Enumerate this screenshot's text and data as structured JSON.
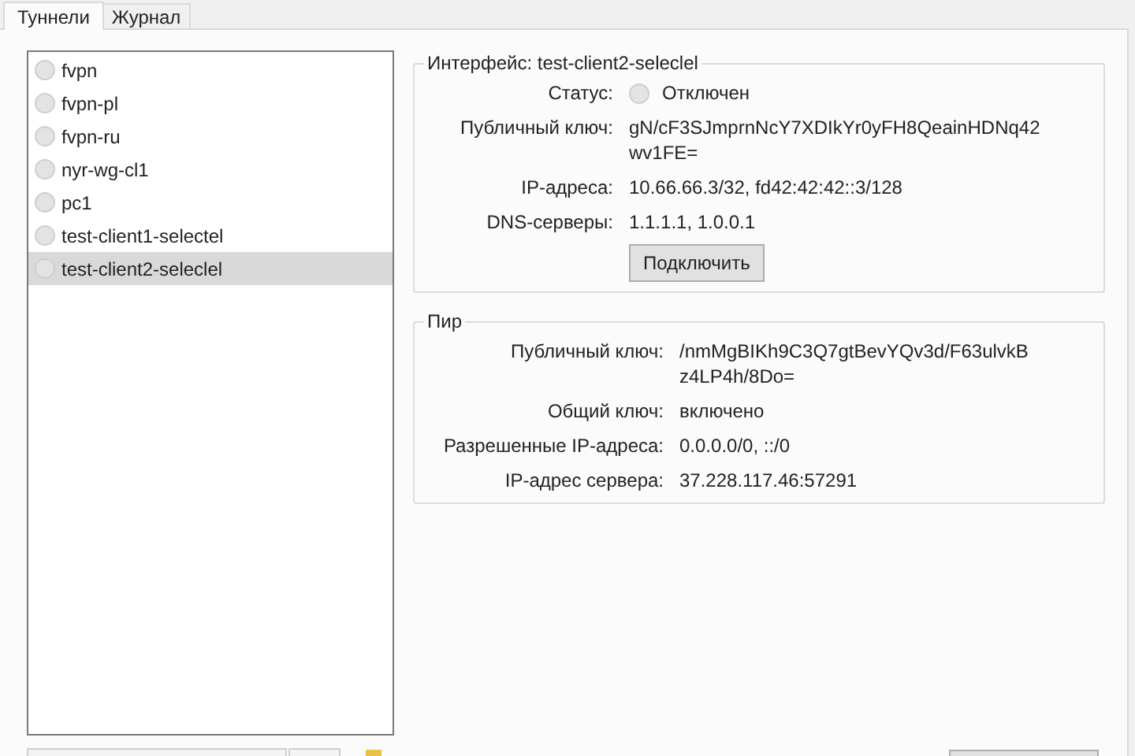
{
  "tabs": [
    {
      "label": "Туннели",
      "selected": true
    },
    {
      "label": "Журнал",
      "selected": false
    }
  ],
  "tunnels": [
    {
      "name": "fvpn",
      "active": false,
      "selected": false
    },
    {
      "name": "fvpn-pl",
      "active": false,
      "selected": false
    },
    {
      "name": "fvpn-ru",
      "active": false,
      "selected": false
    },
    {
      "name": "nyr-wg-cl1",
      "active": false,
      "selected": false
    },
    {
      "name": "pc1",
      "active": false,
      "selected": false
    },
    {
      "name": "test-client1-selectel",
      "active": false,
      "selected": false
    },
    {
      "name": "test-client2-seleclel",
      "active": false,
      "selected": true
    }
  ],
  "interface": {
    "title": "Интерфейс: test-client2-seleclel",
    "status_label": "Статус:",
    "status": "Отключен",
    "active": false,
    "rows": [
      {
        "label": "Публичный ключ:",
        "value": [
          "gN/cF3SJmprnNcY7XDIkYr0yFH8QeainHDNq42",
          "wv1FE="
        ]
      },
      {
        "label": "IP-адреса:",
        "value": "10.66.66.3/32, fd42:42:42::3/128"
      },
      {
        "label": "DNS-серверы:",
        "value": "1.1.1.1, 1.0.0.1"
      }
    ],
    "button": "Подключить"
  },
  "peer": {
    "title": "Пир",
    "rows": [
      {
        "label": "Публичный ключ:",
        "value": [
          "/nmMgBIKh9C3Q7gtBevYQv3d/F63ulvkB",
          "z4LP4h/8Do="
        ]
      },
      {
        "label": "Общий ключ:",
        "value": "включено"
      },
      {
        "label": "Разрешенные IP-адреса:",
        "value": "0.0.0.0/0, ::/0"
      },
      {
        "label": "IP-адрес сервера:",
        "value": "37.228.117.46:57291"
      }
    ]
  }
}
